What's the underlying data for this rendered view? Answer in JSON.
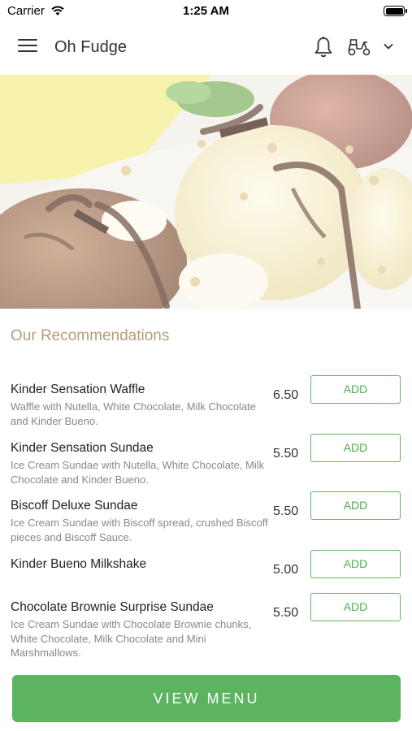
{
  "status_bar": {
    "carrier": "Carrier",
    "time": "1:25 AM"
  },
  "header": {
    "title": "Oh Fudge",
    "icons": [
      "menu-icon",
      "bell-icon",
      "scooter-icon",
      "chevron-down-icon"
    ]
  },
  "hero": {
    "image": "ice-cream-sundae"
  },
  "section": {
    "title": "Our Recommendations"
  },
  "items": [
    {
      "name": "Kinder Sensation Waffle",
      "desc": "Waffle with Nutella, White Chocolate, Milk Chocolate and Kinder Bueno.",
      "price": "6.50",
      "add_label": "ADD"
    },
    {
      "name": "Kinder Sensation Sundae",
      "desc": "Ice Cream Sundae with Nutella, White Chocolate, Milk Chocolate and Kinder Bueno.",
      "price": "5.50",
      "add_label": "ADD"
    },
    {
      "name": "Biscoff Deluxe Sundae",
      "desc": "Ice Cream Sundae with Biscoff spread, crushed Biscoff pieces and Biscoff Sauce.",
      "price": "5.50",
      "add_label": "ADD"
    },
    {
      "name": "Kinder Bueno Milkshake",
      "desc": "",
      "price": "5.00",
      "add_label": "ADD"
    },
    {
      "name": "Chocolate Brownie Surprise Sundae",
      "desc": "Ice Cream Sundae with Chocolate Brownie chunks, White Chocolate, Milk Chocolate and Mini Marshmallows.",
      "price": "5.50",
      "add_label": "ADD"
    }
  ],
  "footer": {
    "view_menu_label": "VIEW MENU"
  },
  "colors": {
    "accent_green": "#5cb461",
    "section_title": "#b29f74"
  }
}
